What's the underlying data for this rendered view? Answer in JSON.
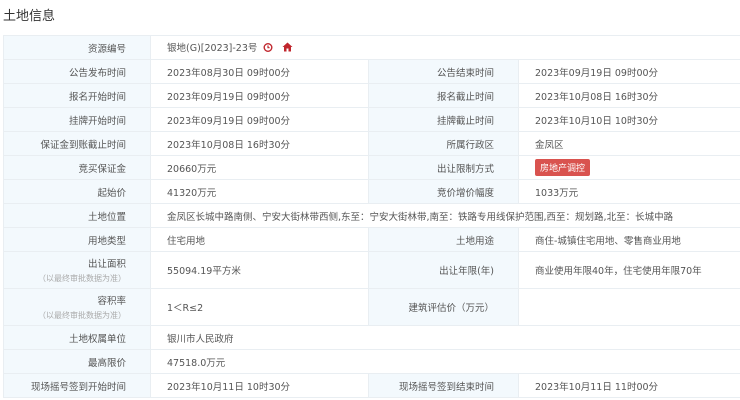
{
  "title": "土地信息",
  "rows": [
    {
      "l1": "资源编号",
      "v1": "银地(G)[2023]-23号"
    },
    {
      "l1": "公告发布时间",
      "v1": "2023年08月30日 09时00分",
      "l2": "公告结束时间",
      "v2": "2023年09月19日 09时00分"
    },
    {
      "l1": "报名开始时间",
      "v1": "2023年09月19日 09时00分",
      "l2": "报名截止时间",
      "v2": "2023年10月08日 16时30分"
    },
    {
      "l1": "挂牌开始时间",
      "v1": "2023年09月19日 09时00分",
      "l2": "挂牌截止时间",
      "v2": "2023年10月10日 10时30分"
    },
    {
      "l1": "保证金到账截止时间",
      "v1": "2023年10月08日 16时30分",
      "l2": "所属行政区",
      "v2": "金凤区"
    },
    {
      "l1": "竞买保证金",
      "v1": "20660万元",
      "l2": "出让限制方式",
      "v2": "房地产调控"
    },
    {
      "l1": "起始价",
      "v1": "41320万元",
      "l2": "竞价增价幅度",
      "v2": "1033万元"
    },
    {
      "l1": "土地位置",
      "v1": "金凤区长城中路南侧、宁安大街林带西侧,东至：宁安大街林带,南至：铁路专用线保护范围,西至：规划路,北至：长城中路"
    },
    {
      "l1": "用地类型",
      "v1": "住宅用地",
      "l2": "土地用途",
      "v2": "商住-城镇住宅用地、零售商业用地"
    },
    {
      "l1": "出让面积",
      "sub": "（以最终审批数据为准）",
      "v1": "55094.19平方米",
      "l2": "出让年限(年)",
      "v2": "商业使用年限40年，住宅使用年限70年"
    },
    {
      "l1": "容积率",
      "sub": "（以最终审批数据为准）",
      "v1": "1＜R≤2",
      "l2": "建筑评估价（万元）",
      "v2": ""
    },
    {
      "l1": "土地权属单位",
      "v1": "银川市人民政府"
    },
    {
      "l1": "最高限价",
      "v1": "47518.0万元"
    },
    {
      "l1": "现场摇号签到开始时间",
      "v1": "2023年10月11日 10时30分",
      "l2": "现场摇号签到结束时间",
      "v2": "2023年10月11日 11时00分"
    }
  ],
  "colors": {
    "badge": "#d9534f",
    "icon": "#c0262d"
  }
}
